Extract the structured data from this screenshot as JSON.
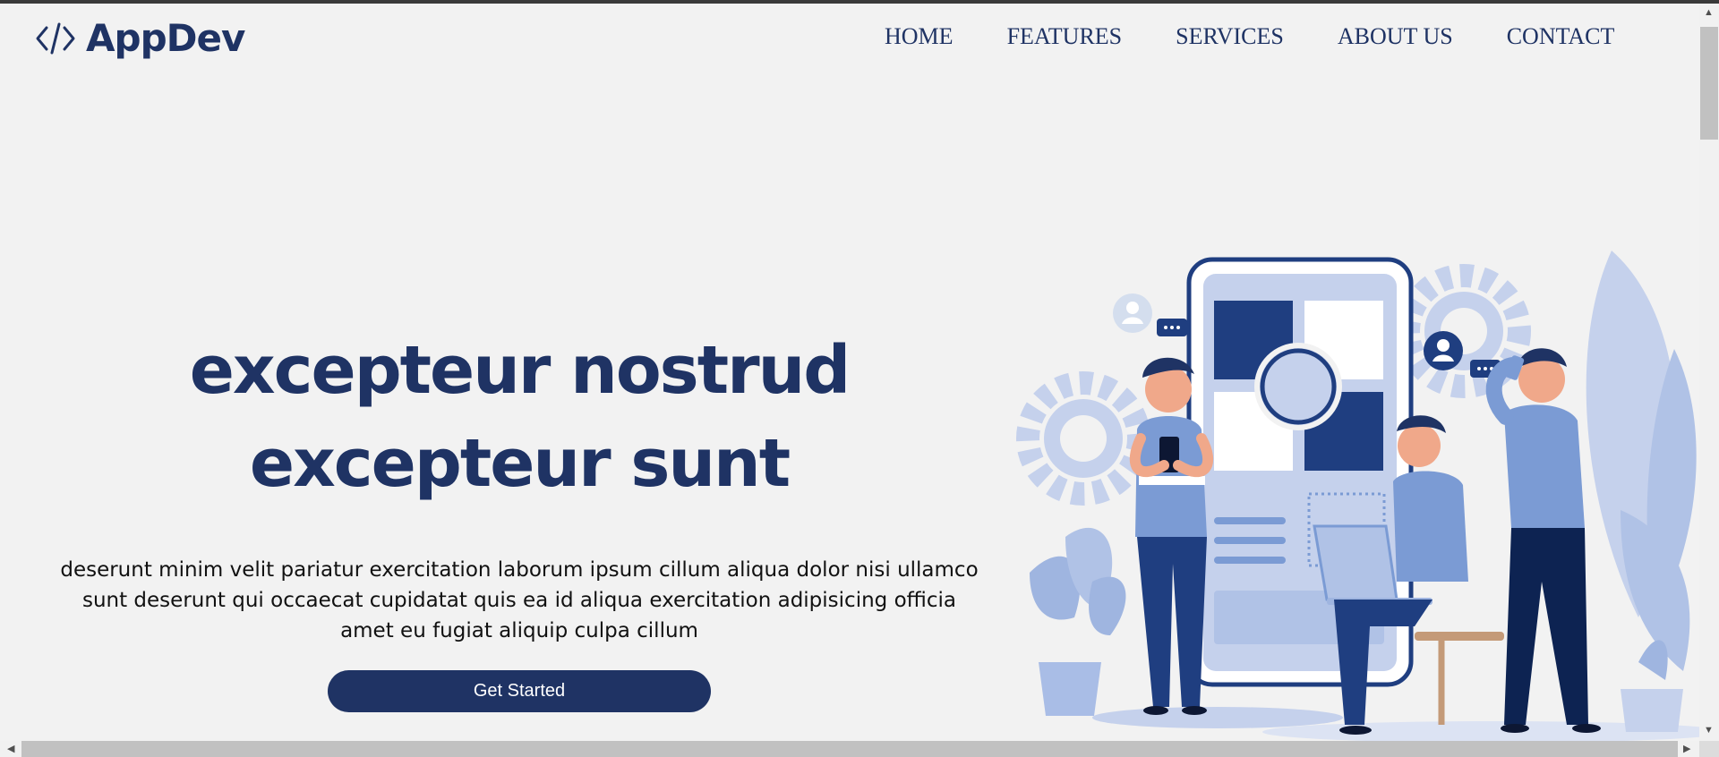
{
  "header": {
    "logo_text": "AppDev",
    "logo_icon": "code-brackets-icon",
    "nav": [
      "HOME",
      "FEATURES",
      "SERVICES",
      "ABOUT US",
      "CONTACT"
    ]
  },
  "hero": {
    "title": "excepteur nostrud excepteur sunt",
    "text": "deserunt minim velit pariatur exercitation laborum ipsum cillum aliqua dolor nisi ullamco sunt deserunt qui occaecat cupidatat quis ea id aliqua exercitation adipisicing officia amet eu fugiat aliquip culpa cillum",
    "cta_label": "Get Started"
  },
  "colors": {
    "brand": "#1f3364",
    "background": "#f2f2f2",
    "illustration_light": "#c5d1ec",
    "illustration_mid": "#7b9bd4"
  }
}
